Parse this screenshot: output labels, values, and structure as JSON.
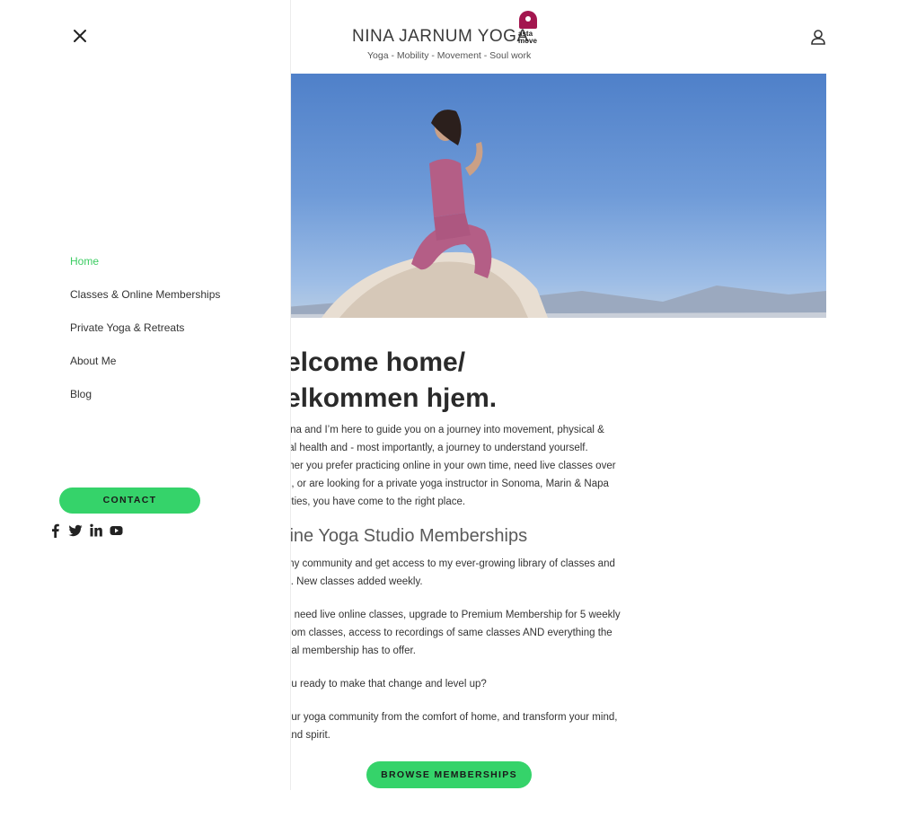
{
  "header": {
    "logo_text": "NINA JARNUM YOGA",
    "logo_badge_line1": "asta",
    "logo_badge_line2": "move",
    "tagline": "Yoga - Mobility - Movement - Soul work"
  },
  "hero": {
    "heading_line1": "elcome home/",
    "heading_line2": "elkommen hjem."
  },
  "intro": [
    "lina and I’m here to guide you on a journey into movement, physical &",
    "tal health and - most importantly, a journey to understand yourself.",
    "ther you prefer practicing online in your own time, need live classes over",
    "h, or are looking for a private yoga instructor in Sonoma, Marin & Napa",
    "nties, you have come to the right place."
  ],
  "memberships_heading": "line Yoga Studio Memberships",
  "membership_paras": [
    [
      "my community and get access to my ever-growing library of classes and",
      "s. New classes added weekly."
    ],
    [
      "u need live online classes, upgrade to Premium Membership for 5 weekly",
      "oom classes, access to recordings of same classes AND everything the",
      "nal membership has to offer."
    ],
    [
      "ou ready to make that change and level up?"
    ],
    [
      "our yoga community from the comfort of home, and transform your mind,",
      "and spirit."
    ]
  ],
  "browse_button": "BROWSE MEMBERSHIPS",
  "menu": {
    "items": [
      {
        "label": "Home",
        "active": true
      },
      {
        "label": "Classes & Online Memberships",
        "active": false
      },
      {
        "label": "Private Yoga & Retreats",
        "active": false
      },
      {
        "label": "About Me",
        "active": false
      },
      {
        "label": "Blog",
        "active": false
      }
    ],
    "contact_button": "CONTACT",
    "social_icons": [
      "facebook-icon",
      "twitter-icon",
      "linkedin-icon",
      "youtube-icon"
    ]
  },
  "colors": {
    "accent": "#35d36a",
    "active_link": "#3bcc62",
    "brand": "#a3164f"
  }
}
